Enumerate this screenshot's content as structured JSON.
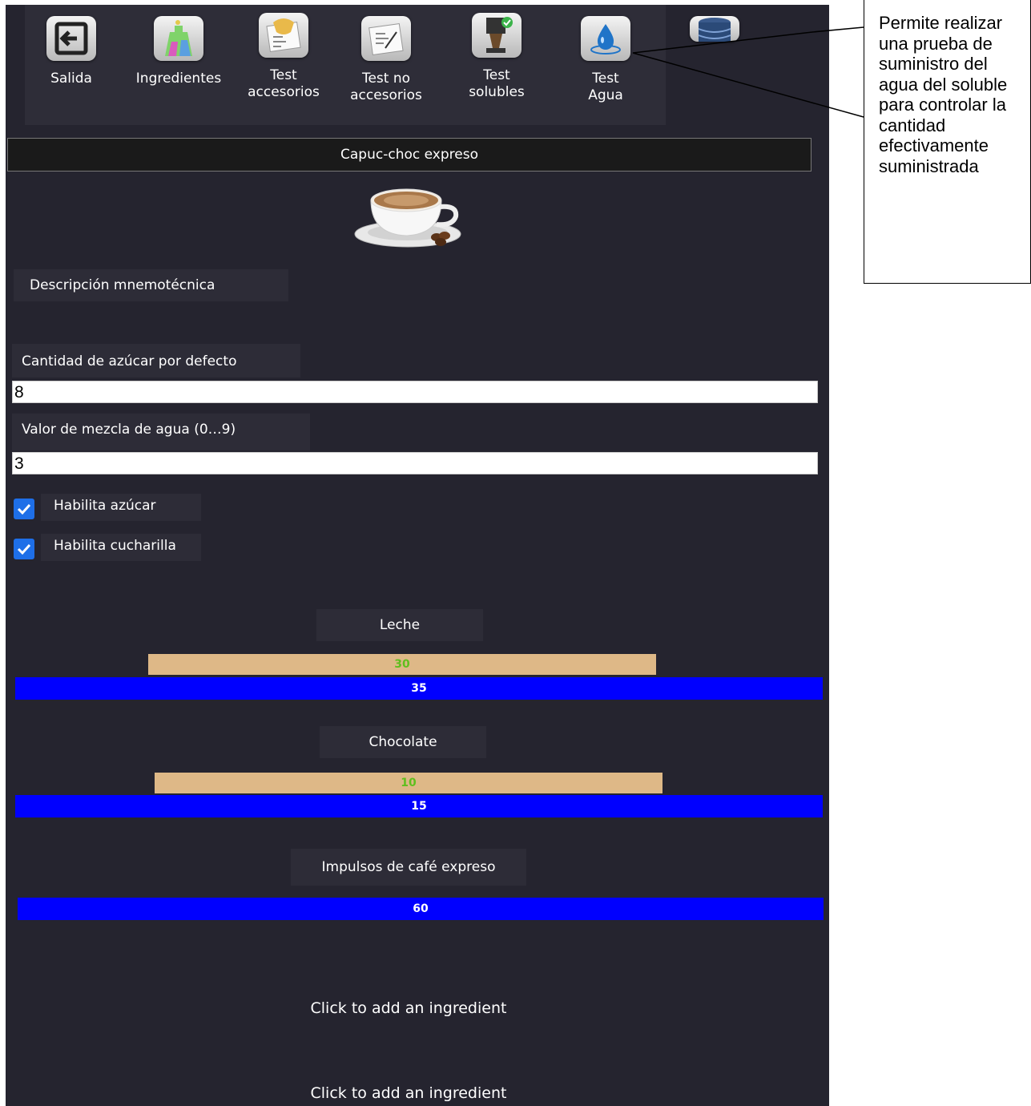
{
  "toolbar": {
    "items": [
      {
        "label": "Salida",
        "icon": "exit-icon"
      },
      {
        "label": "Ingredientes",
        "icon": "flask-icon"
      },
      {
        "label": "Test\naccesorios",
        "icon": "accessories-test-icon"
      },
      {
        "label": "Test no\naccesorios",
        "icon": "no-accessories-test-icon"
      },
      {
        "label": "Test\nsolubles",
        "icon": "solubles-test-icon"
      },
      {
        "label": "Test\nAgua",
        "icon": "water-drop-icon"
      },
      {
        "label": "",
        "icon": "database-icon"
      }
    ]
  },
  "recipe": {
    "name": "Capuc-choc expreso",
    "image_icon": "cappuccino-cup-icon"
  },
  "form": {
    "mnemonic_label": "Descripción mnemotécnica",
    "sugar_label": "Cantidad de azúcar por defecto",
    "sugar_value": "8",
    "water_mix_label": "Valor de mezcla de agua (0…9)",
    "water_mix_value": "3",
    "enable_sugar_label": "Habilita azúcar",
    "enable_spoon_label": "Habilita cucharilla"
  },
  "ingredients": [
    {
      "name": "Leche",
      "tan_value": "30",
      "blue_value": "35"
    },
    {
      "name": "Chocolate",
      "tan_value": "10",
      "blue_value": "15"
    },
    {
      "name": "Impulsos de café expreso",
      "blue_value": "60"
    }
  ],
  "add_ingredient_label": "Click to add an ingredient",
  "callout": {
    "text": "Permite realizar una prueba de suministro del agua del soluble para controlar la cantidad efectivamente suministrada"
  },
  "colors": {
    "app_background": "#25242f",
    "bar_blue": "#0000ff",
    "bar_tan": "#deb887",
    "tan_value_text": "#5fbf1e",
    "checkbox": "#1e6fe8"
  }
}
